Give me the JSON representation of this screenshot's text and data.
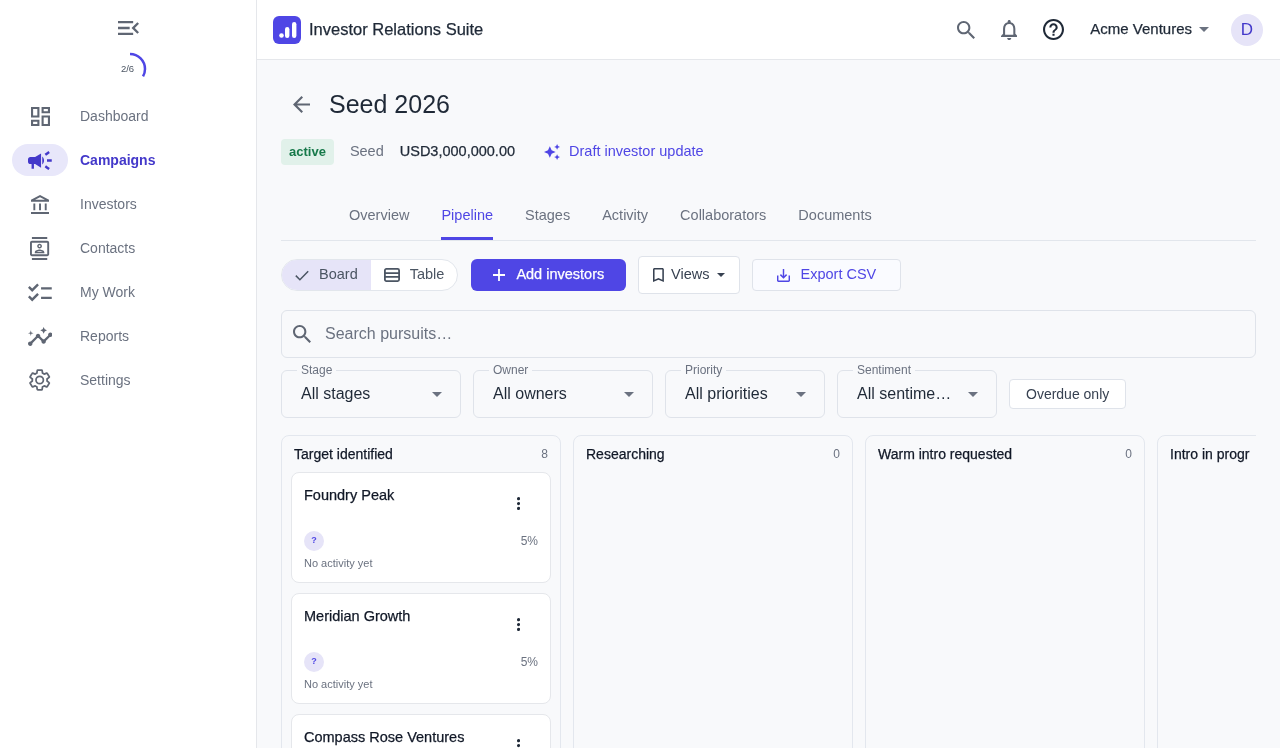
{
  "sidebar": {
    "progress": {
      "label": "2/6",
      "level": 0.333
    },
    "items": [
      {
        "label": "Dashboard",
        "kind": "dashboard",
        "selected": false
      },
      {
        "label": "Campaigns",
        "kind": "campaigns",
        "selected": true
      },
      {
        "label": "Investors",
        "kind": "investors",
        "selected": false
      },
      {
        "label": "Contacts",
        "kind": "contacts",
        "selected": false
      },
      {
        "label": "My Work",
        "kind": "tasks",
        "selected": false
      },
      {
        "label": "Reports",
        "kind": "reports",
        "selected": false
      },
      {
        "label": "Settings",
        "kind": "settings",
        "selected": false
      }
    ]
  },
  "top_bar": {
    "title": "Investor Relations Suite",
    "account": "Acme Ventures",
    "avatar": "D"
  },
  "campaign": {
    "title": "Seed 2026",
    "status": "active",
    "round": "Seed",
    "amount": "USD3,000,000.00",
    "action": "Draft investor update"
  },
  "tabs": [
    {
      "label": "Overview",
      "selected": false
    },
    {
      "label": "Pipeline",
      "selected": true
    },
    {
      "label": "Stages",
      "selected": false
    },
    {
      "label": "Activity",
      "selected": false
    },
    {
      "label": "Collaborators",
      "selected": false
    },
    {
      "label": "Documents",
      "selected": false
    }
  ],
  "toolbar": {
    "view_modes": [
      {
        "label": "Board",
        "selected": true
      },
      {
        "label": "Table",
        "kind": "table",
        "selected": false
      }
    ],
    "add_button": "Add investors",
    "views_button": "Views",
    "export_button": "Export CSV"
  },
  "search": {
    "placeholder": "Search pursuits…"
  },
  "filters": [
    {
      "label": "Stage",
      "value": "All stages"
    },
    {
      "label": "Owner",
      "value": "All owners"
    },
    {
      "label": "Priority",
      "value": "All priorities"
    },
    {
      "label": "Sentiment",
      "value": "All sentime…"
    }
  ],
  "overdue_button": "Overdue only",
  "columns": [
    {
      "title": "Target identified",
      "count": "8",
      "cards": [
        {
          "name": "Foundry Peak",
          "owner": "?",
          "probability": "5%",
          "activity": "No activity yet"
        },
        {
          "name": "Meridian Growth",
          "owner": "?",
          "probability": "5%",
          "activity": "No activity yet"
        },
        {
          "name": "Compass Rose Ventures"
        }
      ]
    },
    {
      "title": "Researching",
      "count": "0"
    },
    {
      "title": "Warm intro requested",
      "count": "0"
    },
    {
      "title": "Intro in progr"
    }
  ]
}
